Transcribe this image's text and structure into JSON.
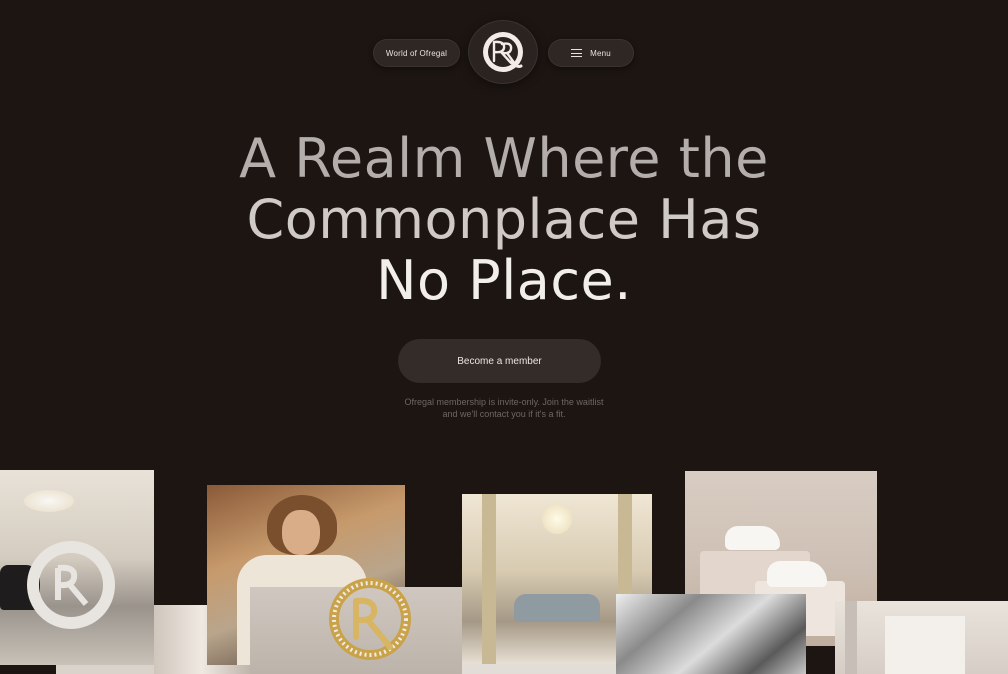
{
  "nav": {
    "world_label": "World of Ofregal",
    "menu_label": "Menu",
    "logo_icon": "ofregal-monogram-logo"
  },
  "hero": {
    "line1": "A Realm Where the",
    "line2": "Commonplace Has",
    "line3": "No Place."
  },
  "cta": {
    "label": "Become a member",
    "note": "Ofregal membership is invite-only. Join the waitlist and we'll contact you if it's a fit."
  },
  "colors": {
    "background": "#1c1512",
    "pill": "#2e2724",
    "cta": "#342c29",
    "note_text": "#6f6660"
  },
  "gallery": {
    "images": [
      "luxury-car-showroom-with-monogram",
      "woman-in-vintage-car",
      "jeweled-monogram-brooch",
      "classical-lobby-with-sofa",
      "white-sneakers-on-pedestals",
      "silver-sculpture",
      "minimal-white-room",
      "draped-fabric",
      "stone-texture"
    ]
  }
}
